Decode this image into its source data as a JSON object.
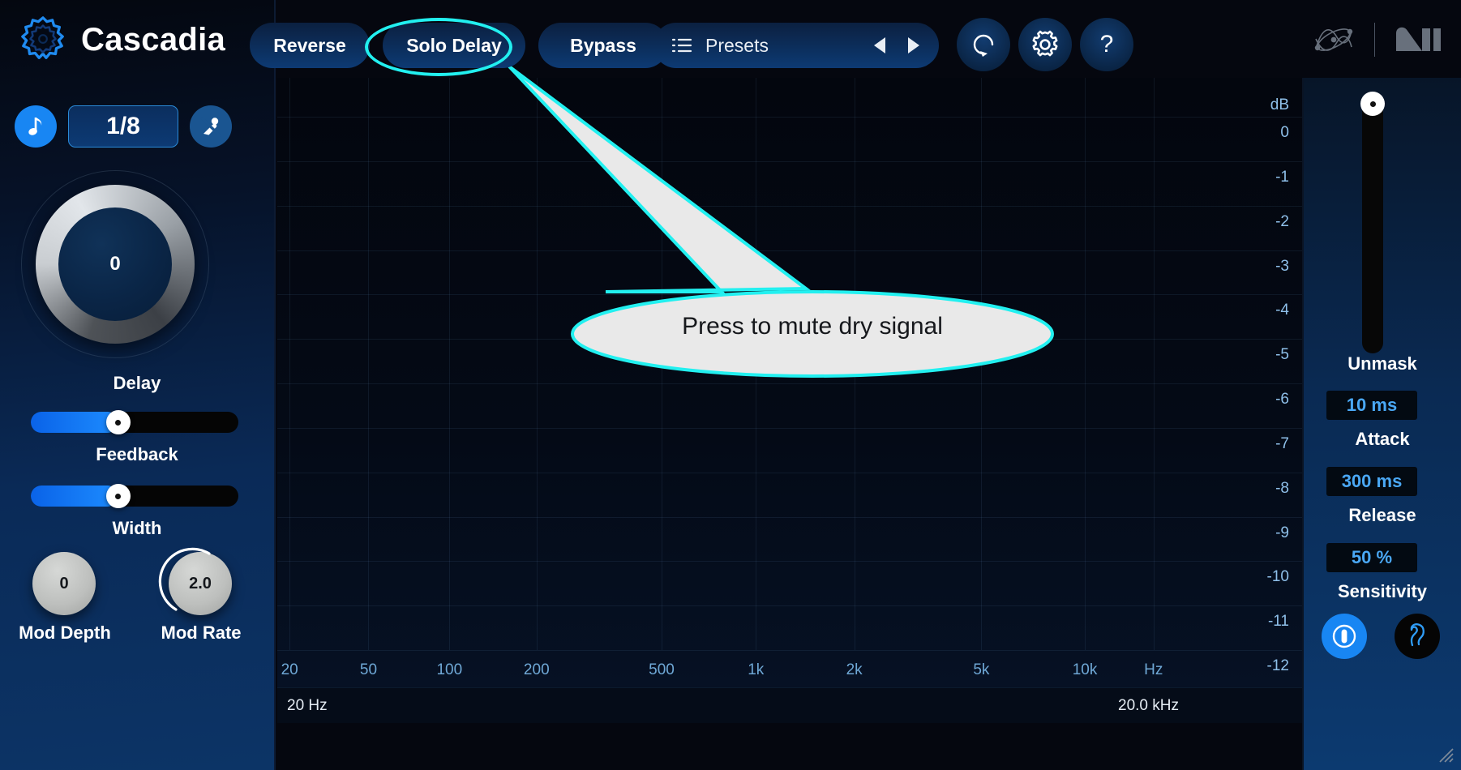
{
  "app": {
    "brand": "Cascadia"
  },
  "topbar": {
    "reverse_label": "Reverse",
    "solo_delay_label": "Solo Delay",
    "bypass_label": "Bypass",
    "presets_label": "Presets",
    "prev_icon": "triangle-left-icon",
    "next_icon": "triangle-right-icon",
    "reset_icon": "reset-icon",
    "settings_icon": "gear-icon",
    "help_icon": "question-mark-icon",
    "wave_logo_icon": "waveform-logo-icon",
    "ni_logo_icon": "native-instruments-logo-icon"
  },
  "sidebar": {
    "note_icon": "eighth-note-icon",
    "division_value": "1/8",
    "ping_icon": "ping-pong-icon",
    "delay": {
      "value": "0",
      "label": "Delay"
    },
    "feedback": {
      "label": "Feedback",
      "fill_percent": 42
    },
    "width": {
      "label": "Width",
      "fill_percent": 42
    },
    "mod_depth": {
      "value": "0",
      "label": "Mod Depth"
    },
    "mod_rate": {
      "value": "2.0",
      "label": "Mod Rate"
    }
  },
  "spectrum": {
    "db_axis_label": "dB",
    "freq_low_label": "20 Hz",
    "freq_high_label": "20.0 kHz"
  },
  "chart_data": {
    "type": "line",
    "title": "",
    "xlabel": "Hz",
    "ylabel": "dB",
    "x_ticks": [
      "20",
      "50",
      "100",
      "200",
      "500",
      "1k",
      "2k",
      "5k",
      "10k",
      "Hz"
    ],
    "x_tick_positions": [
      0.012,
      0.089,
      0.168,
      0.253,
      0.375,
      0.467,
      0.563,
      0.687,
      0.788,
      0.855
    ],
    "y_ticks": [
      "0",
      "-1",
      "-2",
      "-3",
      "-4",
      "-5",
      "-6",
      "-7",
      "-8",
      "-9",
      "-10",
      "-11",
      "-12"
    ],
    "ylim": [
      -12,
      0
    ],
    "xlim_label": [
      "20 Hz",
      "20.0 kHz"
    ],
    "grid": true,
    "series": []
  },
  "callout": {
    "text": "Press to mute dry signal",
    "outline_color": "#22f0f0",
    "fill_color": "#e9e9e9"
  },
  "rightpanel": {
    "unmask_label": "Unmask",
    "attack": {
      "value": "10 ms",
      "label": "Attack"
    },
    "release": {
      "value": "300 ms",
      "label": "Release"
    },
    "sensitivity": {
      "value": "50 %",
      "label": "Sensitivity"
    },
    "power_icon": "power-toggle-icon",
    "listen_icon": "ear-listen-icon",
    "resize_icon": "resize-grip-icon"
  },
  "colors": {
    "accent_blue": "#1886f3",
    "cyan_highlight": "#22f0f0",
    "value_blue": "#4aa8f5"
  }
}
